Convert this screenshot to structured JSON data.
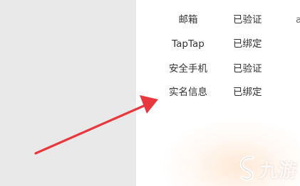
{
  "account_bindings": [
    {
      "label": "邮箱",
      "status": "已验证"
    },
    {
      "label": "TapTap",
      "status": "已绑定"
    },
    {
      "label": "安全手机",
      "status": "已验证"
    },
    {
      "label": "实名信息",
      "status": "已绑定"
    }
  ],
  "annotation": {
    "arrow_color": "#e8383d",
    "arrow_target": "实名信息"
  },
  "watermark": {
    "text": "九游"
  }
}
